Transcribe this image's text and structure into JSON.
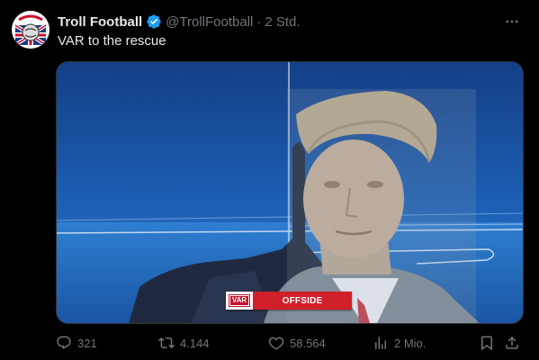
{
  "tweet": {
    "display_name": "Troll Football",
    "handle": "@TrollFootball",
    "separator": "·",
    "time": "2 Std.",
    "text": "VAR to the rescue",
    "verified": true
  },
  "media": {
    "banner_badge": "VAR",
    "banner_text": "OFFSIDE"
  },
  "actions": {
    "replies": "321",
    "retweets": "4.144",
    "likes": "58.564",
    "views": "2 Mio."
  },
  "colors": {
    "background": "#000000",
    "text_primary": "#e7e9ea",
    "text_secondary": "#71767b",
    "verified_blue": "#1d9bf0",
    "banner_red": "#d11f2b"
  },
  "icons": {
    "more": "more-icon",
    "reply": "reply-icon",
    "retweet": "retweet-icon",
    "like": "heart-icon",
    "views": "views-icon",
    "bookmark": "bookmark-icon",
    "share": "share-icon"
  }
}
